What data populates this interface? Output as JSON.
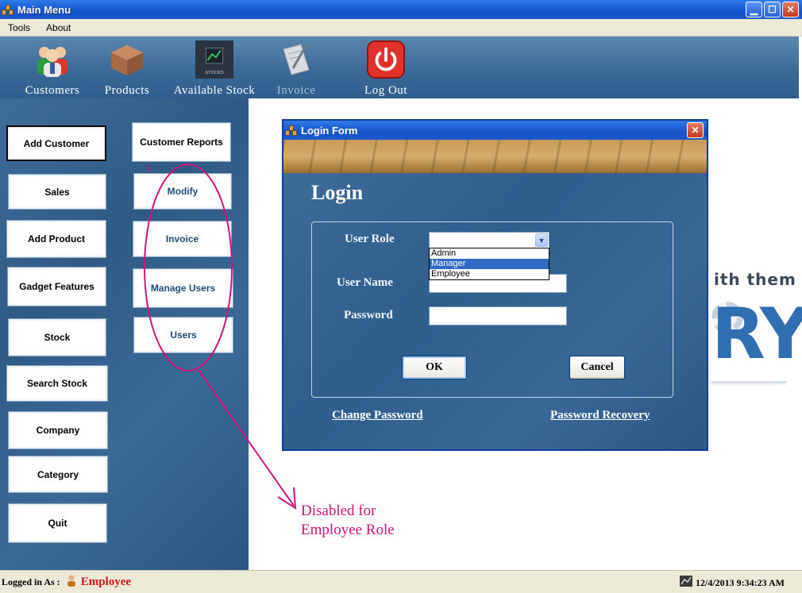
{
  "window": {
    "title": "Main Menu"
  },
  "menu": {
    "items": [
      "Tools",
      "About"
    ]
  },
  "toolbar": {
    "items": [
      {
        "label": "Customers",
        "icon": "customers-icon",
        "enabled": true
      },
      {
        "label": "Products",
        "icon": "products-box-icon",
        "enabled": true
      },
      {
        "label": "Available Stock",
        "icon": "stocks-icon",
        "enabled": true
      },
      {
        "label": "Invoice",
        "icon": "invoice-icon",
        "enabled": false
      },
      {
        "label": "Log Out",
        "icon": "power-icon",
        "enabled": true
      }
    ],
    "stocks_icon_text": "STOCKS"
  },
  "sidebar": {
    "left": [
      "Add Customer",
      "Sales",
      "Add Product",
      "Gadget Features",
      "Stock",
      "Search Stock",
      "Company",
      "Category",
      "Quit"
    ],
    "right": [
      "Customer Reports",
      "Modify",
      "Invoice",
      "Manage Users",
      "Users"
    ]
  },
  "background_logo": {
    "line1": "ith them",
    "line2": "RY"
  },
  "login": {
    "window_title": "Login Form",
    "heading": "Login",
    "user_role_label": "User Role",
    "user_role_value": "",
    "role_options": [
      "Admin",
      "Manager",
      "Employee"
    ],
    "highlighted_option": "Manager",
    "user_name_label": "User Name",
    "user_name_value": "",
    "password_label": "Password",
    "password_value": "",
    "ok_label": "OK",
    "cancel_label": "Cancel",
    "change_password_link": "Change Password",
    "password_recovery_link": "Password Recovery"
  },
  "annotation": {
    "line1": "Disabled for",
    "line2": "Employee Role",
    "color": "#d0147a"
  },
  "status": {
    "logged_in_label": "Logged in As :",
    "user": "Employee",
    "datetime": "12/4/2013 9:34:23 AM"
  },
  "colors": {
    "titlebar": "#1c5fd6",
    "panel": "#2f5a86",
    "user_text": "#c41a1a"
  }
}
